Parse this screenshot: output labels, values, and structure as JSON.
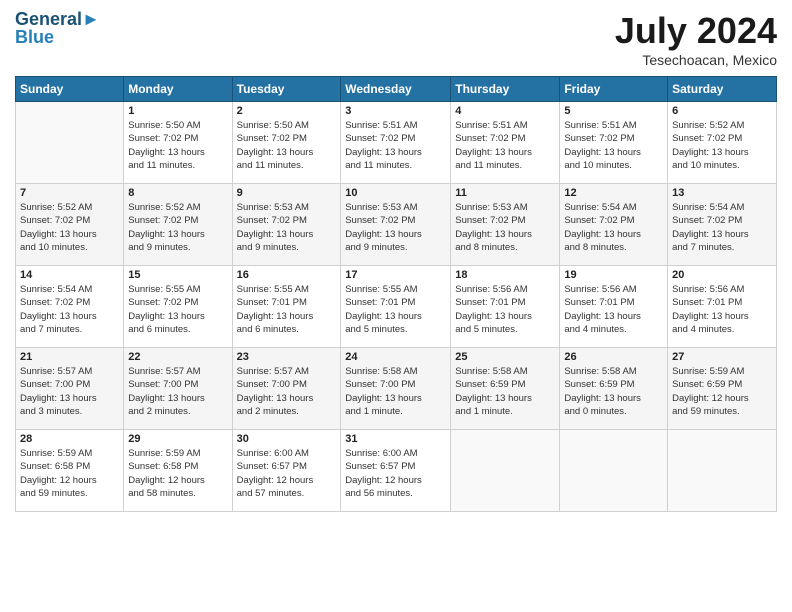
{
  "header": {
    "logo_line1": "General",
    "logo_line2": "Blue",
    "month_title": "July 2024",
    "location": "Tesechoacan, Mexico"
  },
  "days_of_week": [
    "Sunday",
    "Monday",
    "Tuesday",
    "Wednesday",
    "Thursday",
    "Friday",
    "Saturday"
  ],
  "weeks": [
    [
      {
        "day": "",
        "sunrise": "",
        "sunset": "",
        "daylight": ""
      },
      {
        "day": "1",
        "sunrise": "Sunrise: 5:50 AM",
        "sunset": "Sunset: 7:02 PM",
        "daylight": "Daylight: 13 hours and 11 minutes."
      },
      {
        "day": "2",
        "sunrise": "Sunrise: 5:50 AM",
        "sunset": "Sunset: 7:02 PM",
        "daylight": "Daylight: 13 hours and 11 minutes."
      },
      {
        "day": "3",
        "sunrise": "Sunrise: 5:51 AM",
        "sunset": "Sunset: 7:02 PM",
        "daylight": "Daylight: 13 hours and 11 minutes."
      },
      {
        "day": "4",
        "sunrise": "Sunrise: 5:51 AM",
        "sunset": "Sunset: 7:02 PM",
        "daylight": "Daylight: 13 hours and 11 minutes."
      },
      {
        "day": "5",
        "sunrise": "Sunrise: 5:51 AM",
        "sunset": "Sunset: 7:02 PM",
        "daylight": "Daylight: 13 hours and 10 minutes."
      },
      {
        "day": "6",
        "sunrise": "Sunrise: 5:52 AM",
        "sunset": "Sunset: 7:02 PM",
        "daylight": "Daylight: 13 hours and 10 minutes."
      }
    ],
    [
      {
        "day": "7",
        "sunrise": "Sunrise: 5:52 AM",
        "sunset": "Sunset: 7:02 PM",
        "daylight": "Daylight: 13 hours and 10 minutes."
      },
      {
        "day": "8",
        "sunrise": "Sunrise: 5:52 AM",
        "sunset": "Sunset: 7:02 PM",
        "daylight": "Daylight: 13 hours and 9 minutes."
      },
      {
        "day": "9",
        "sunrise": "Sunrise: 5:53 AM",
        "sunset": "Sunset: 7:02 PM",
        "daylight": "Daylight: 13 hours and 9 minutes."
      },
      {
        "day": "10",
        "sunrise": "Sunrise: 5:53 AM",
        "sunset": "Sunset: 7:02 PM",
        "daylight": "Daylight: 13 hours and 9 minutes."
      },
      {
        "day": "11",
        "sunrise": "Sunrise: 5:53 AM",
        "sunset": "Sunset: 7:02 PM",
        "daylight": "Daylight: 13 hours and 8 minutes."
      },
      {
        "day": "12",
        "sunrise": "Sunrise: 5:54 AM",
        "sunset": "Sunset: 7:02 PM",
        "daylight": "Daylight: 13 hours and 8 minutes."
      },
      {
        "day": "13",
        "sunrise": "Sunrise: 5:54 AM",
        "sunset": "Sunset: 7:02 PM",
        "daylight": "Daylight: 13 hours and 7 minutes."
      }
    ],
    [
      {
        "day": "14",
        "sunrise": "Sunrise: 5:54 AM",
        "sunset": "Sunset: 7:02 PM",
        "daylight": "Daylight: 13 hours and 7 minutes."
      },
      {
        "day": "15",
        "sunrise": "Sunrise: 5:55 AM",
        "sunset": "Sunset: 7:02 PM",
        "daylight": "Daylight: 13 hours and 6 minutes."
      },
      {
        "day": "16",
        "sunrise": "Sunrise: 5:55 AM",
        "sunset": "Sunset: 7:01 PM",
        "daylight": "Daylight: 13 hours and 6 minutes."
      },
      {
        "day": "17",
        "sunrise": "Sunrise: 5:55 AM",
        "sunset": "Sunset: 7:01 PM",
        "daylight": "Daylight: 13 hours and 5 minutes."
      },
      {
        "day": "18",
        "sunrise": "Sunrise: 5:56 AM",
        "sunset": "Sunset: 7:01 PM",
        "daylight": "Daylight: 13 hours and 5 minutes."
      },
      {
        "day": "19",
        "sunrise": "Sunrise: 5:56 AM",
        "sunset": "Sunset: 7:01 PM",
        "daylight": "Daylight: 13 hours and 4 minutes."
      },
      {
        "day": "20",
        "sunrise": "Sunrise: 5:56 AM",
        "sunset": "Sunset: 7:01 PM",
        "daylight": "Daylight: 13 hours and 4 minutes."
      }
    ],
    [
      {
        "day": "21",
        "sunrise": "Sunrise: 5:57 AM",
        "sunset": "Sunset: 7:00 PM",
        "daylight": "Daylight: 13 hours and 3 minutes."
      },
      {
        "day": "22",
        "sunrise": "Sunrise: 5:57 AM",
        "sunset": "Sunset: 7:00 PM",
        "daylight": "Daylight: 13 hours and 2 minutes."
      },
      {
        "day": "23",
        "sunrise": "Sunrise: 5:57 AM",
        "sunset": "Sunset: 7:00 PM",
        "daylight": "Daylight: 13 hours and 2 minutes."
      },
      {
        "day": "24",
        "sunrise": "Sunrise: 5:58 AM",
        "sunset": "Sunset: 7:00 PM",
        "daylight": "Daylight: 13 hours and 1 minute."
      },
      {
        "day": "25",
        "sunrise": "Sunrise: 5:58 AM",
        "sunset": "Sunset: 6:59 PM",
        "daylight": "Daylight: 13 hours and 1 minute."
      },
      {
        "day": "26",
        "sunrise": "Sunrise: 5:58 AM",
        "sunset": "Sunset: 6:59 PM",
        "daylight": "Daylight: 13 hours and 0 minutes."
      },
      {
        "day": "27",
        "sunrise": "Sunrise: 5:59 AM",
        "sunset": "Sunset: 6:59 PM",
        "daylight": "Daylight: 12 hours and 59 minutes."
      }
    ],
    [
      {
        "day": "28",
        "sunrise": "Sunrise: 5:59 AM",
        "sunset": "Sunset: 6:58 PM",
        "daylight": "Daylight: 12 hours and 59 minutes."
      },
      {
        "day": "29",
        "sunrise": "Sunrise: 5:59 AM",
        "sunset": "Sunset: 6:58 PM",
        "daylight": "Daylight: 12 hours and 58 minutes."
      },
      {
        "day": "30",
        "sunrise": "Sunrise: 6:00 AM",
        "sunset": "Sunset: 6:57 PM",
        "daylight": "Daylight: 12 hours and 57 minutes."
      },
      {
        "day": "31",
        "sunrise": "Sunrise: 6:00 AM",
        "sunset": "Sunset: 6:57 PM",
        "daylight": "Daylight: 12 hours and 56 minutes."
      },
      {
        "day": "",
        "sunrise": "",
        "sunset": "",
        "daylight": ""
      },
      {
        "day": "",
        "sunrise": "",
        "sunset": "",
        "daylight": ""
      },
      {
        "day": "",
        "sunrise": "",
        "sunset": "",
        "daylight": ""
      }
    ]
  ]
}
